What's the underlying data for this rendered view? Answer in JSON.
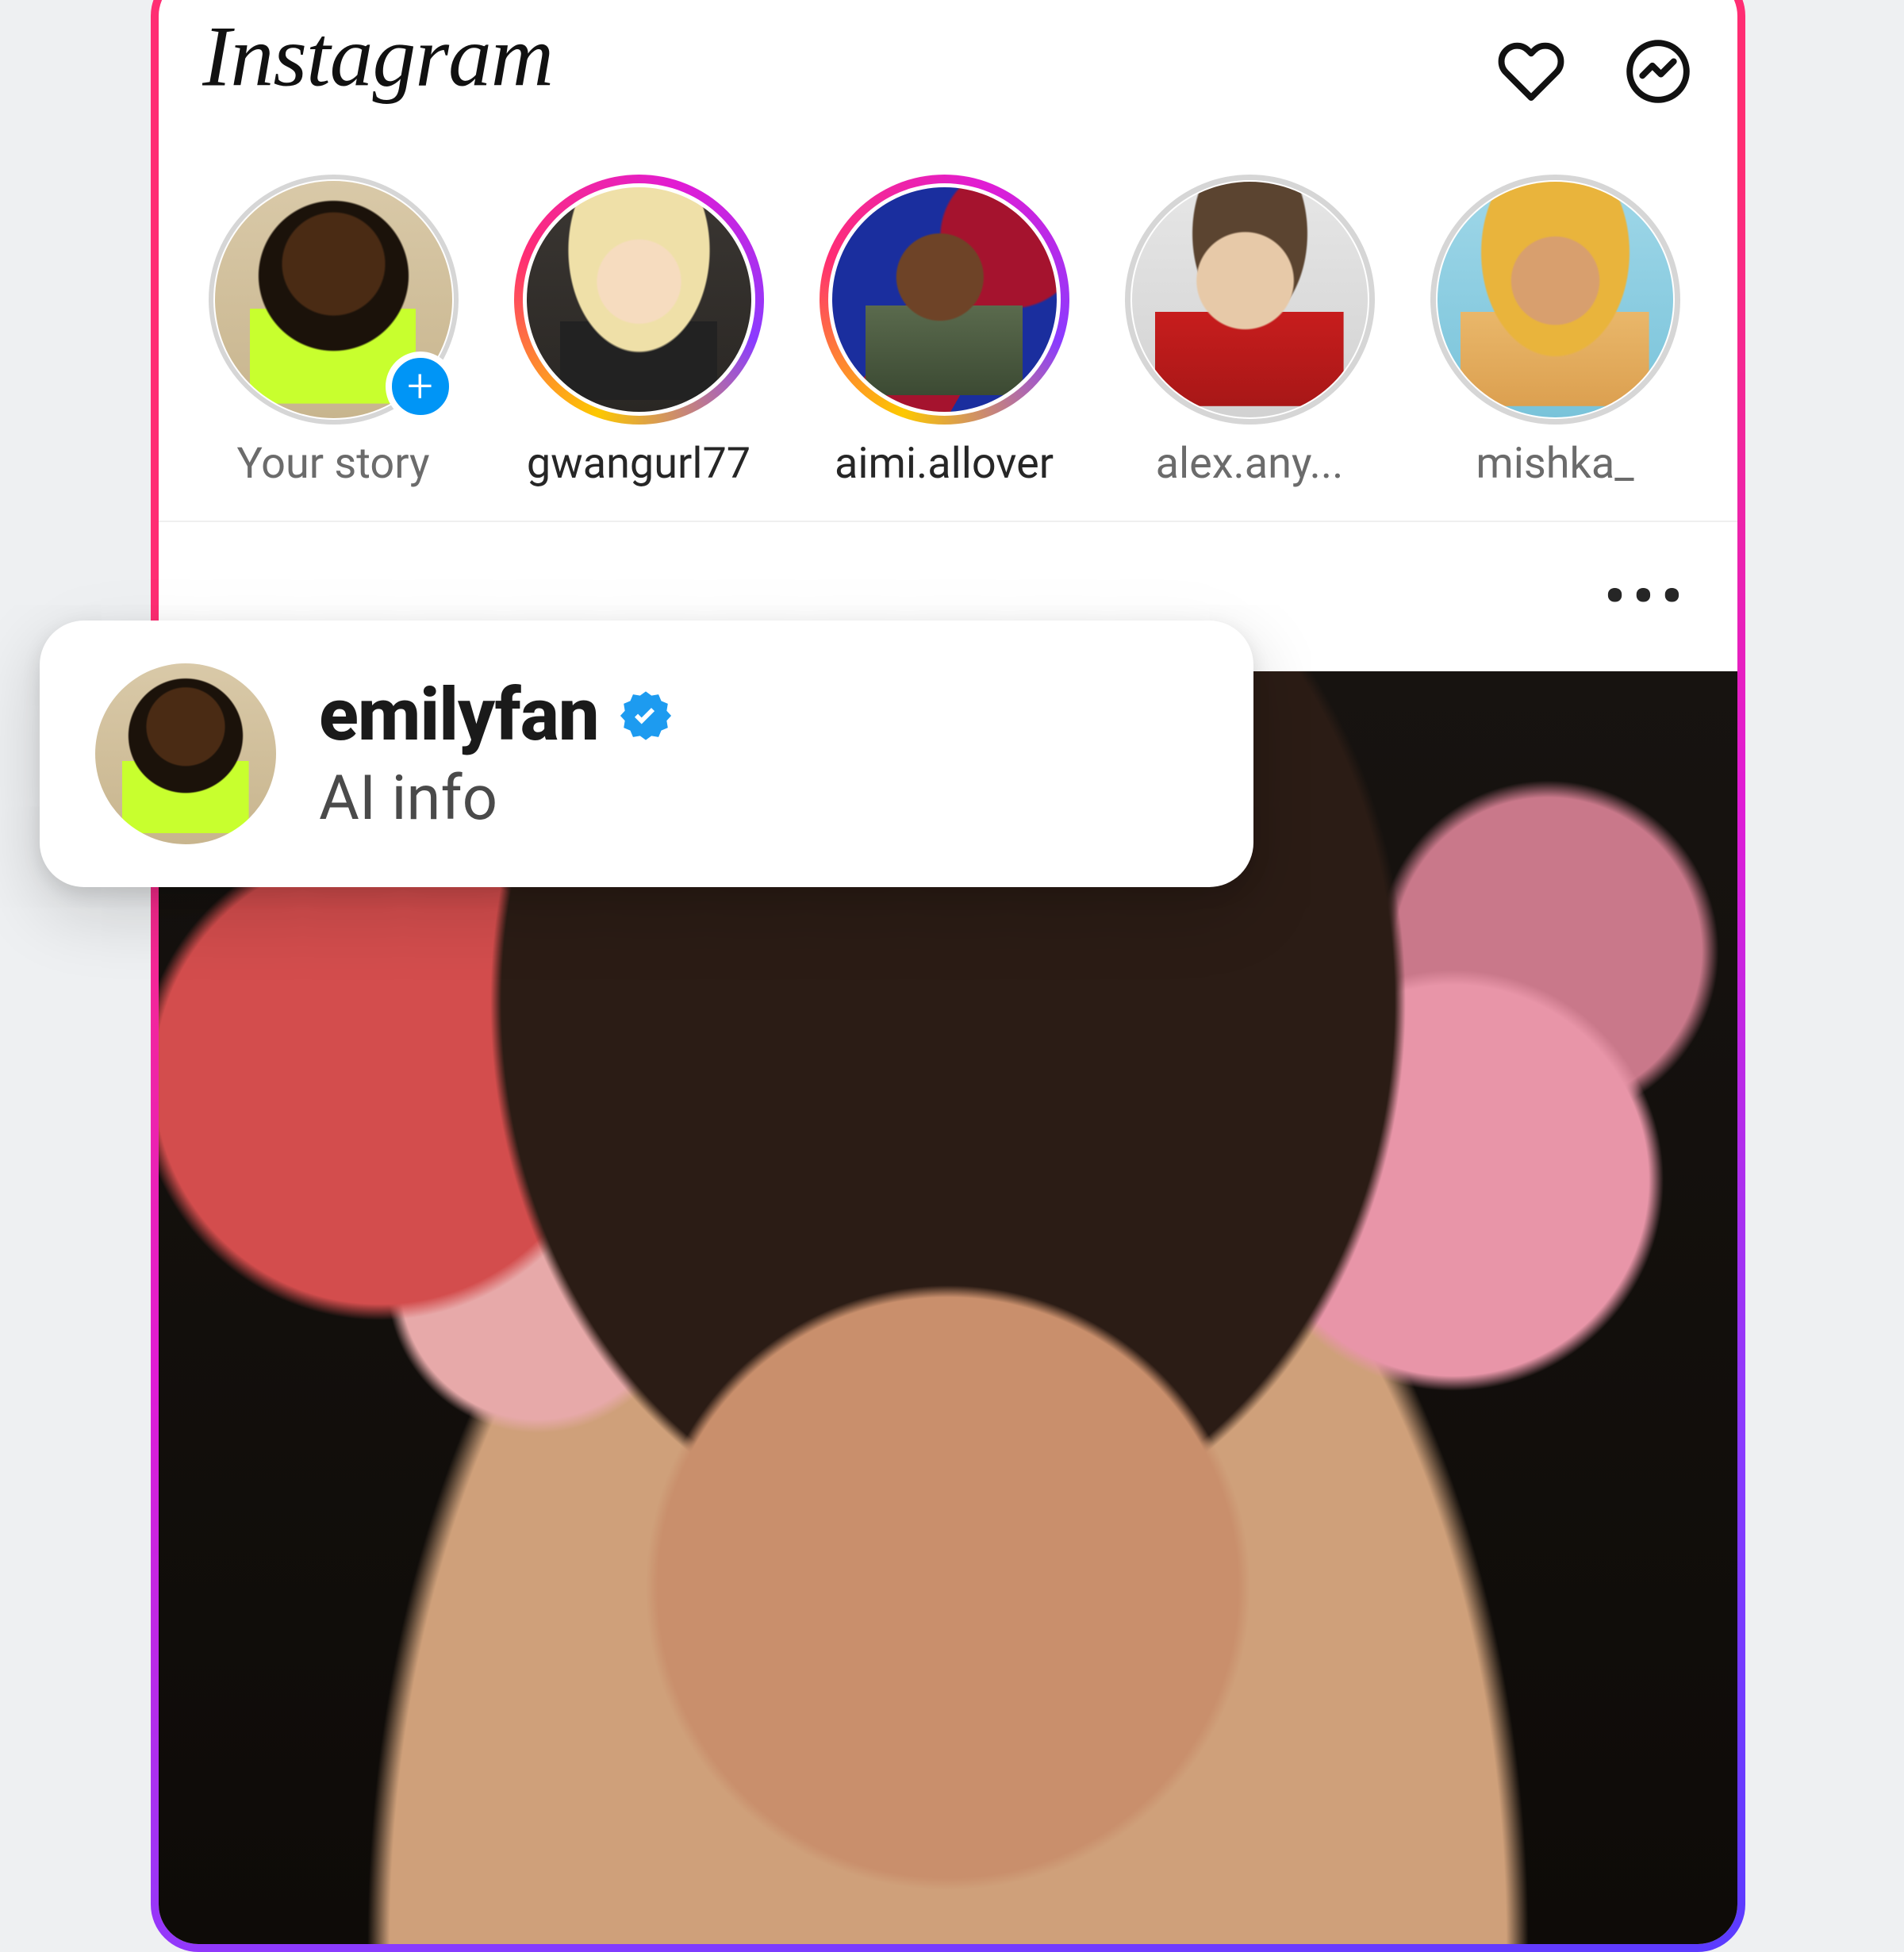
{
  "app": {
    "name": "Instagram"
  },
  "header": {
    "icons": {
      "activity": "heart-icon",
      "messages": "messenger-icon"
    }
  },
  "stories": [
    {
      "label": "Your story",
      "state": "self",
      "avatar": "emily",
      "has_add": true
    },
    {
      "label": "gwangurl77",
      "state": "unseen",
      "avatar": "gwan"
    },
    {
      "label": "aimi.allover",
      "state": "unseen",
      "avatar": "aimi"
    },
    {
      "label": "alex.any...",
      "state": "seen",
      "avatar": "alex"
    },
    {
      "label": "mishka_",
      "state": "seen",
      "avatar": "mishka"
    }
  ],
  "post": {
    "more_label": "•••"
  },
  "popover": {
    "username": "emilyfan",
    "verified": true,
    "subtext": "AI info",
    "avatar": "emily"
  },
  "colors": {
    "verified_blue": "#1d9bf0",
    "add_blue": "#0095f6"
  }
}
